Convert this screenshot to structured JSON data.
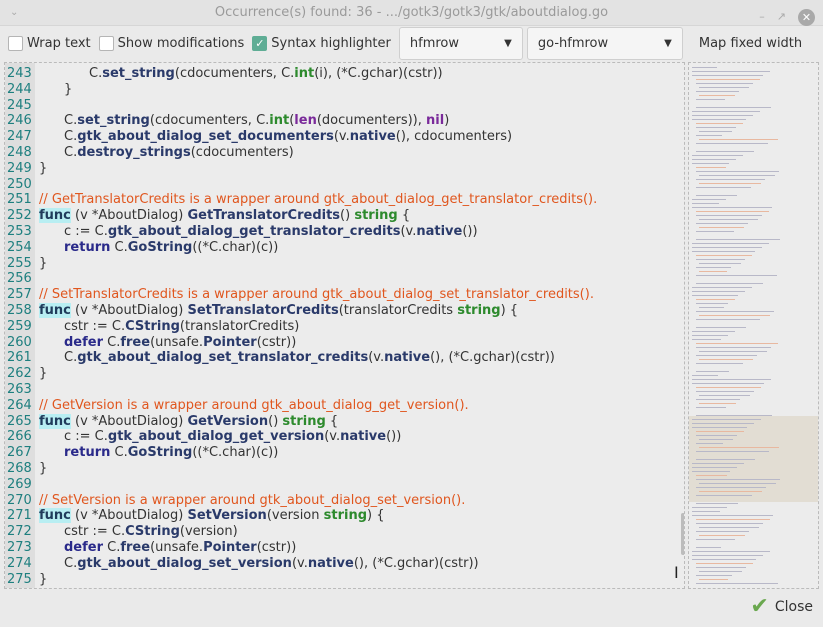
{
  "window": {
    "title": "Occurrence(s) found: 36 - .../gotk3/gotk3/gtk/aboutdialog.go"
  },
  "toolbar": {
    "wrap_text": {
      "label": "Wrap text",
      "checked": false
    },
    "show_modifications": {
      "label": "Show modifications",
      "checked": false
    },
    "syntax_highlighter": {
      "label": "Syntax highlighter",
      "checked": true
    },
    "style_combo": "hfmrow",
    "lang_combo": "go-hfmrow",
    "map_fixed_width": "Map fixed width"
  },
  "editor": {
    "lines": [
      {
        "n": "243",
        "i": 2,
        "t": [
          [
            "C.",
            "n"
          ],
          [
            "set_string",
            "f"
          ],
          [
            "(cdocumenters, C.",
            "n"
          ],
          [
            "int",
            "t"
          ],
          [
            "(i), (*C.gchar)(cstr))",
            "n"
          ]
        ]
      },
      {
        "n": "244",
        "i": 1,
        "t": [
          [
            "}",
            "n"
          ]
        ]
      },
      {
        "n": "245",
        "i": 0,
        "t": []
      },
      {
        "n": "246",
        "i": 1,
        "t": [
          [
            "C.",
            "n"
          ],
          [
            "set_string",
            "f"
          ],
          [
            "(cdocumenters, C.",
            "n"
          ],
          [
            "int",
            "t"
          ],
          [
            "(",
            "n"
          ],
          [
            "len",
            "b"
          ],
          [
            "(documenters)), ",
            "n"
          ],
          [
            "nil",
            "b"
          ],
          [
            ")",
            "n"
          ]
        ]
      },
      {
        "n": "247",
        "i": 1,
        "t": [
          [
            "C.",
            "n"
          ],
          [
            "gtk_about_dialog_set_documenters",
            "f"
          ],
          [
            "(v.",
            "n"
          ],
          [
            "native",
            "f"
          ],
          [
            "(), cdocumenters)",
            "n"
          ]
        ]
      },
      {
        "n": "248",
        "i": 1,
        "t": [
          [
            "C.",
            "n"
          ],
          [
            "destroy_strings",
            "f"
          ],
          [
            "(cdocumenters)",
            "n"
          ]
        ]
      },
      {
        "n": "249",
        "i": 0,
        "t": [
          [
            "}",
            "n"
          ]
        ]
      },
      {
        "n": "250",
        "i": 0,
        "t": []
      },
      {
        "n": "251",
        "i": 0,
        "t": [
          [
            "// GetTranslatorCredits is a wrapper around gtk_about_dialog_get_translator_credits().",
            "c"
          ]
        ]
      },
      {
        "n": "252",
        "i": 0,
        "t": [
          [
            "func",
            "fn"
          ],
          [
            " (v *AboutDialog) ",
            "n"
          ],
          [
            "GetTranslatorCredits",
            "f"
          ],
          [
            "() ",
            "n"
          ],
          [
            "string",
            "t"
          ],
          [
            " {",
            "n"
          ]
        ]
      },
      {
        "n": "253",
        "i": 1,
        "t": [
          [
            "c := C.",
            "n"
          ],
          [
            "gtk_about_dialog_get_translator_credits",
            "f"
          ],
          [
            "(v.",
            "n"
          ],
          [
            "native",
            "f"
          ],
          [
            "())",
            "n"
          ]
        ]
      },
      {
        "n": "254",
        "i": 1,
        "t": [
          [
            "return",
            "k"
          ],
          [
            " C.",
            "n"
          ],
          [
            "GoString",
            "f"
          ],
          [
            "((*C.char)(c))",
            "n"
          ]
        ]
      },
      {
        "n": "255",
        "i": 0,
        "t": [
          [
            "}",
            "n"
          ]
        ]
      },
      {
        "n": "256",
        "i": 0,
        "t": []
      },
      {
        "n": "257",
        "i": 0,
        "t": [
          [
            "// SetTranslatorCredits is a wrapper around gtk_about_dialog_set_translator_credits().",
            "c"
          ]
        ]
      },
      {
        "n": "258",
        "i": 0,
        "t": [
          [
            "func",
            "fn"
          ],
          [
            " (v *AboutDialog) ",
            "n"
          ],
          [
            "SetTranslatorCredits",
            "f"
          ],
          [
            "(translatorCredits ",
            "n"
          ],
          [
            "string",
            "t"
          ],
          [
            ") {",
            "n"
          ]
        ]
      },
      {
        "n": "259",
        "i": 1,
        "t": [
          [
            "cstr := C.",
            "n"
          ],
          [
            "CString",
            "f"
          ],
          [
            "(translatorCredits)",
            "n"
          ]
        ]
      },
      {
        "n": "260",
        "i": 1,
        "t": [
          [
            "defer",
            "k"
          ],
          [
            " C.",
            "n"
          ],
          [
            "free",
            "f"
          ],
          [
            "(unsafe.",
            "n"
          ],
          [
            "Pointer",
            "f"
          ],
          [
            "(cstr))",
            "n"
          ]
        ]
      },
      {
        "n": "261",
        "i": 1,
        "t": [
          [
            "C.",
            "n"
          ],
          [
            "gtk_about_dialog_set_translator_credits",
            "f"
          ],
          [
            "(v.",
            "n"
          ],
          [
            "native",
            "f"
          ],
          [
            "(), (*C.gchar)(cstr))",
            "n"
          ]
        ]
      },
      {
        "n": "262",
        "i": 0,
        "t": [
          [
            "}",
            "n"
          ]
        ]
      },
      {
        "n": "263",
        "i": 0,
        "t": []
      },
      {
        "n": "264",
        "i": 0,
        "t": [
          [
            "// GetVersion is a wrapper around gtk_about_dialog_get_version().",
            "c"
          ]
        ]
      },
      {
        "n": "265",
        "i": 0,
        "t": [
          [
            "func",
            "fn"
          ],
          [
            " (v *AboutDialog) ",
            "n"
          ],
          [
            "GetVersion",
            "f"
          ],
          [
            "() ",
            "n"
          ],
          [
            "string",
            "t"
          ],
          [
            " {",
            "n"
          ]
        ]
      },
      {
        "n": "266",
        "i": 1,
        "t": [
          [
            "c := C.",
            "n"
          ],
          [
            "gtk_about_dialog_get_version",
            "f"
          ],
          [
            "(v.",
            "n"
          ],
          [
            "native",
            "f"
          ],
          [
            "())",
            "n"
          ]
        ]
      },
      {
        "n": "267",
        "i": 1,
        "t": [
          [
            "return",
            "k"
          ],
          [
            " C.",
            "n"
          ],
          [
            "GoString",
            "f"
          ],
          [
            "((*C.char)(c))",
            "n"
          ]
        ]
      },
      {
        "n": "268",
        "i": 0,
        "t": [
          [
            "}",
            "n"
          ]
        ]
      },
      {
        "n": "269",
        "i": 0,
        "t": []
      },
      {
        "n": "270",
        "i": 0,
        "t": [
          [
            "// SetVersion is a wrapper around gtk_about_dialog_set_version().",
            "c"
          ]
        ]
      },
      {
        "n": "271",
        "i": 0,
        "t": [
          [
            "func",
            "fn"
          ],
          [
            " (v *AboutDialog) ",
            "n"
          ],
          [
            "SetVersion",
            "f"
          ],
          [
            "(version ",
            "n"
          ],
          [
            "string",
            "t"
          ],
          [
            ") {",
            "n"
          ]
        ]
      },
      {
        "n": "272",
        "i": 1,
        "t": [
          [
            "cstr := C.",
            "n"
          ],
          [
            "CString",
            "f"
          ],
          [
            "(version)",
            "n"
          ]
        ]
      },
      {
        "n": "273",
        "i": 1,
        "t": [
          [
            "defer",
            "k"
          ],
          [
            " C.",
            "n"
          ],
          [
            "free",
            "f"
          ],
          [
            "(unsafe.",
            "n"
          ],
          [
            "Pointer",
            "f"
          ],
          [
            "(cstr))",
            "n"
          ]
        ]
      },
      {
        "n": "274",
        "i": 1,
        "t": [
          [
            "C.",
            "n"
          ],
          [
            "gtk_about_dialog_set_version",
            "f"
          ],
          [
            "(v.",
            "n"
          ],
          [
            "native",
            "f"
          ],
          [
            "(), (*C.gchar)(cstr))",
            "n"
          ]
        ]
      },
      {
        "n": "275",
        "i": 0,
        "t": [
          [
            "}",
            "n"
          ]
        ]
      }
    ]
  },
  "footer": {
    "close_label": "Close"
  },
  "colors": {
    "accent": "#5fad95",
    "comment": "#e0561e",
    "line_number": "#1e7f7f",
    "func_highlight": "#b8eef2"
  },
  "icons": {
    "window_menu": "chevron-down-icon",
    "minimize": "minimize-icon",
    "maximize": "maximize-icon",
    "close": "close-icon",
    "close_button": "checkmark-icon"
  }
}
